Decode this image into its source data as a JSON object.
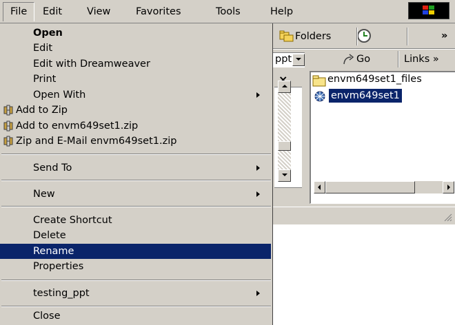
{
  "menubar": {
    "items": [
      "File",
      "Edit",
      "View",
      "Favorites",
      "Tools",
      "Help"
    ]
  },
  "toolbar": {
    "folders_label": "Folders",
    "chevron": "»",
    "address_fragment": "ppt",
    "go_label": "Go",
    "links_label": "Links »"
  },
  "tree_pane": {
    "close_glyph": "×"
  },
  "file_list": {
    "items": [
      {
        "name": "envm649set1_files",
        "icon": "folder-icon",
        "selected": false
      },
      {
        "name": "envm649set1",
        "icon": "web-document-icon",
        "selected": true
      }
    ]
  },
  "file_menu": {
    "groups": [
      [
        {
          "label": "Open",
          "bold": true
        },
        {
          "label": "Edit"
        },
        {
          "label": "Edit with Dreamweaver"
        },
        {
          "label": "Print"
        },
        {
          "label": "Open With",
          "submenu": true
        },
        {
          "label": "Add to Zip",
          "icon": "winzip-icon"
        },
        {
          "label": "Add to envm649set1.zip",
          "icon": "winzip-icon"
        },
        {
          "label": "Zip and E-Mail envm649set1.zip",
          "icon": "winzip-icon"
        }
      ],
      [
        {
          "label": "Send To",
          "submenu": true
        }
      ],
      [
        {
          "label": "New",
          "submenu": true
        }
      ],
      [
        {
          "label": "Create Shortcut"
        },
        {
          "label": "Delete"
        },
        {
          "label": "Rename",
          "highlighted": true
        },
        {
          "label": "Properties"
        }
      ],
      [
        {
          "label": "testing_ppt",
          "submenu": true
        }
      ],
      [
        {
          "label": "Close"
        }
      ]
    ]
  },
  "colors": {
    "highlight": "#0a246a",
    "face": "#d4d0c8",
    "shadow": "#808080"
  }
}
